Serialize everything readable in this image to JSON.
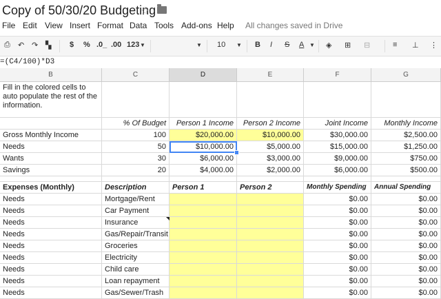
{
  "doc": {
    "title": "Copy of 50/30/20 Budgeting"
  },
  "menu": {
    "items": [
      "File",
      "Edit",
      "View",
      "Insert",
      "Format",
      "Data",
      "Tools",
      "Add-ons",
      "Help"
    ],
    "status": "All changes saved in Drive"
  },
  "toolbar": {
    "currency": "$",
    "percent": "%",
    "dec_less": ".0_",
    "dec_more": ".00",
    "number_format": "123",
    "font_size": "10",
    "bold": "B",
    "italic": "I",
    "strike": "S",
    "text_color": "A"
  },
  "formula": {
    "text": "=(C4/100)*D3"
  },
  "columns": [
    "B",
    "C",
    "D",
    "E",
    "F",
    "G"
  ],
  "selected_column": "D",
  "intro_text": "Fill in the colored cells to auto populate the rest of the information.",
  "income_headers": [
    "% Of Budget",
    "Person 1 Income",
    "Person 2 Income",
    "Joint Income",
    "Monthly Income"
  ],
  "income_rows": [
    {
      "label": "Gross Monthly Income",
      "pct": "100",
      "p1": "$20,000.00",
      "p2": "$10,000.00",
      "joint": "$30,000.00",
      "monthly": "$2,500.00"
    },
    {
      "label": "Needs",
      "pct": "50",
      "p1": "$10,000.00",
      "p2": "$5,000.00",
      "joint": "$15,000.00",
      "monthly": "$1,250.00"
    },
    {
      "label": "Wants",
      "pct": "30",
      "p1": "$6,000.00",
      "p2": "$3,000.00",
      "joint": "$9,000.00",
      "monthly": "$750.00"
    },
    {
      "label": "Savings",
      "pct": "20",
      "p1": "$4,000.00",
      "p2": "$2,000.00",
      "joint": "$6,000.00",
      "monthly": "$500.00"
    }
  ],
  "expense_headers": [
    "Expenses (Monthly)",
    "Description",
    "Person 1",
    "Person 2",
    "Monthly Spending",
    "Annual Spending"
  ],
  "expense_rows": [
    {
      "cat": "Needs",
      "desc": "Mortgage/Rent",
      "monthly": "$0.00",
      "annual": "$0.00"
    },
    {
      "cat": "Needs",
      "desc": "Car Payment",
      "monthly": "$0.00",
      "annual": "$0.00"
    },
    {
      "cat": "Needs",
      "desc": "Insurance",
      "monthly": "$0.00",
      "annual": "$0.00"
    },
    {
      "cat": "Needs",
      "desc": "Gas/Repair/Transit",
      "monthly": "$0.00",
      "annual": "$0.00"
    },
    {
      "cat": "Needs",
      "desc": "Groceries",
      "monthly": "$0.00",
      "annual": "$0.00"
    },
    {
      "cat": "Needs",
      "desc": "Electricity",
      "monthly": "$0.00",
      "annual": "$0.00"
    },
    {
      "cat": "Needs",
      "desc": "Child care",
      "monthly": "$0.00",
      "annual": "$0.00"
    },
    {
      "cat": "Needs",
      "desc": "Loan repayment",
      "monthly": "$0.00",
      "annual": "$0.00"
    },
    {
      "cat": "Needs",
      "desc": "Gas/Sewer/Trash",
      "monthly": "$0.00",
      "annual": "$0.00"
    }
  ]
}
